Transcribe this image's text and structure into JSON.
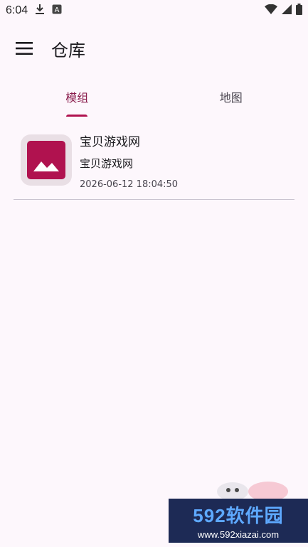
{
  "status_bar": {
    "time": "6:04",
    "icons": [
      "download-icon",
      "a-icon",
      "wifi-icon",
      "signal-icon",
      "battery-icon"
    ]
  },
  "app_bar": {
    "title": "仓库",
    "menu_icon": "menu-icon"
  },
  "tabs": [
    {
      "label": "模组",
      "active": true
    },
    {
      "label": "地图",
      "active": false
    }
  ],
  "list": [
    {
      "title": "宝贝游戏网",
      "subtitle": "宝贝游戏网",
      "date": "2026-06-12 18:04:50",
      "thumbnail_icon": "image-icon"
    }
  ],
  "watermark": {
    "brand": "592软件园",
    "url": "www.592xiazai.com"
  },
  "colors": {
    "background": "#fdf7fc",
    "accent": "#b0124f",
    "active_tab_text": "#8a1c4c",
    "thumbnail_bg": "#e9dfe5"
  }
}
